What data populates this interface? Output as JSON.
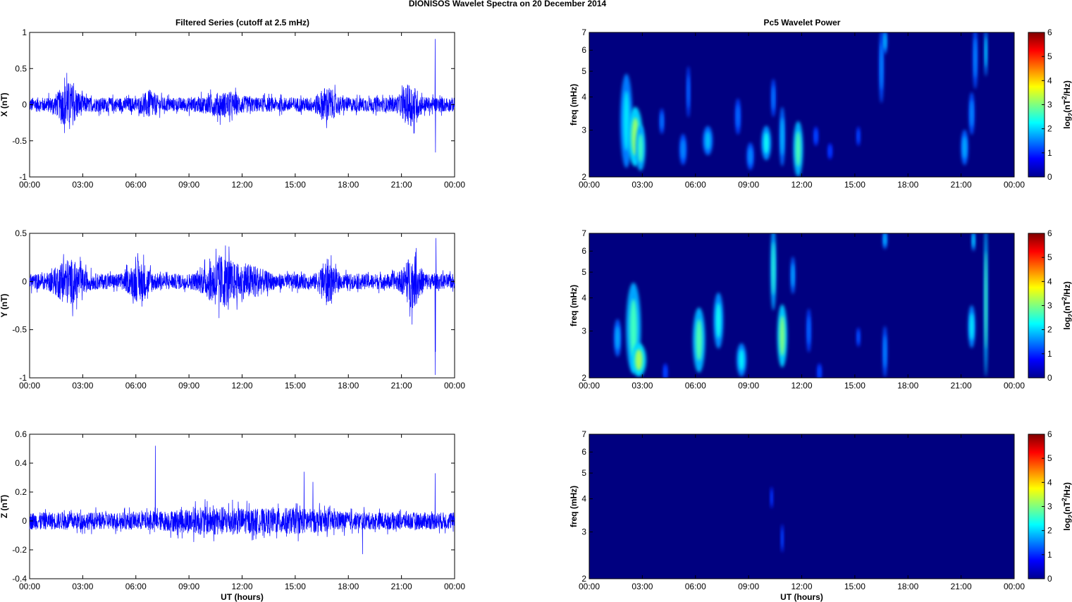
{
  "title": "DIONISOS Wavelet Spectra on 20 December  2014",
  "chart_data": [
    {
      "type": "line",
      "title": "Filtered Series (cutoff at 2.5 mHz)",
      "ylabel": "X (nT)",
      "xlabel": "",
      "ylim": [
        -1,
        1
      ],
      "yticks": [
        "-1",
        "-0.5",
        "0",
        "0.5",
        "1"
      ],
      "ytick_values": [
        -1,
        -0.5,
        0,
        0.5,
        1
      ],
      "base_amplitude": 0.1,
      "bursts": [
        [
          2.2,
          0.22,
          0.6
        ],
        [
          6.8,
          0.1,
          0.4
        ],
        [
          16.8,
          0.16,
          0.5
        ],
        [
          21.5,
          0.2,
          0.5
        ],
        [
          11,
          0.08,
          1
        ]
      ],
      "spikes": [
        [
          22.9,
          0.91
        ],
        [
          22.92,
          -0.66
        ],
        [
          21.7,
          -0.4
        ],
        [
          2.1,
          0.44
        ]
      ]
    },
    {
      "type": "line",
      "title": "",
      "ylabel": "Y (nT)",
      "xlabel": "",
      "ylim": [
        -1,
        0.5
      ],
      "yticks": [
        "-1",
        "-0.5",
        "0",
        "0.5"
      ],
      "ytick_values": [
        -1,
        -0.5,
        0,
        0.5
      ],
      "base_amplitude": 0.08,
      "bursts": [
        [
          2.2,
          0.16,
          0.8
        ],
        [
          6.2,
          0.14,
          0.6
        ],
        [
          10.8,
          0.2,
          0.9
        ],
        [
          12.5,
          0.1,
          0.8
        ],
        [
          16.8,
          0.16,
          0.4
        ],
        [
          21.6,
          0.2,
          0.5
        ]
      ],
      "spikes": [
        [
          22.95,
          0.45
        ],
        [
          22.9,
          -0.97
        ],
        [
          22.92,
          -0.73
        ],
        [
          10.7,
          -0.38
        ]
      ]
    },
    {
      "type": "line",
      "title": "",
      "ylabel": "Z (nT)",
      "xlabel": "UT (hours)",
      "ylim": [
        -0.4,
        0.6
      ],
      "yticks": [
        "-0.4",
        "-0.2",
        "0",
        "0.2",
        "0.4",
        "0.6"
      ],
      "ytick_values": [
        -0.4,
        -0.2,
        0,
        0.2,
        0.4,
        0.6
      ],
      "base_amplitude": 0.06,
      "bursts": [
        [
          10.5,
          0.04,
          2.5
        ],
        [
          15,
          0.03,
          2
        ]
      ],
      "spikes": [
        [
          7.1,
          0.52
        ],
        [
          15.5,
          0.34
        ],
        [
          18.8,
          -0.23
        ],
        [
          22.9,
          0.33
        ],
        [
          16,
          0.27
        ]
      ]
    },
    {
      "type": "heatmap",
      "title": "Pc5 Wavelet Power",
      "ylabel": "freq (mHz)",
      "xlabel": "",
      "colorbar_label": "log2(nT2/Hz)",
      "clim": [
        0,
        6
      ],
      "yticks": [
        "2",
        "3",
        "4",
        "5",
        "6",
        "7"
      ],
      "ytick_values": [
        2,
        3,
        4,
        5,
        6,
        7
      ],
      "blobs": [
        [
          2.1,
          2.3,
          4.6,
          1.5,
          0.25
        ],
        [
          2.6,
          2.3,
          3.5,
          2.5,
          0.3
        ],
        [
          2.9,
          2.2,
          3,
          2,
          0.2
        ],
        [
          4.1,
          3,
          3.5,
          0.9,
          0.1
        ],
        [
          5.3,
          2.3,
          2.8,
          1,
          0.15
        ],
        [
          5.6,
          3.5,
          5,
          0.8,
          0.08
        ],
        [
          6.7,
          2.5,
          3,
          1.3,
          0.2
        ],
        [
          8.4,
          3,
          3.8,
          0.8,
          0.12
        ],
        [
          9.1,
          2.2,
          2.6,
          1,
          0.15
        ],
        [
          10,
          2.4,
          3,
          1.7,
          0.2
        ],
        [
          10.4,
          3.5,
          4.5,
          0.9,
          0.1
        ],
        [
          10.9,
          2.3,
          3.5,
          1.3,
          0.12
        ],
        [
          11.8,
          2.1,
          3.1,
          2.1,
          0.2
        ],
        [
          12.8,
          2.7,
          3,
          0.6,
          0.1
        ],
        [
          13.6,
          2.4,
          2.6,
          0.5,
          0.1
        ],
        [
          15.2,
          2.7,
          3,
          0.6,
          0.08
        ],
        [
          16.5,
          4,
          6.8,
          1,
          0.1
        ],
        [
          16.7,
          6,
          7,
          1.3,
          0.1
        ],
        [
          21.2,
          2.3,
          2.9,
          1.2,
          0.15
        ],
        [
          21.6,
          3,
          4,
          1,
          0.12
        ],
        [
          21.8,
          4.5,
          7,
          1,
          0.1
        ],
        [
          22.4,
          5,
          7,
          1.5,
          0.07
        ]
      ]
    },
    {
      "type": "heatmap",
      "title": "",
      "ylabel": "freq (mHz)",
      "xlabel": "",
      "colorbar_label": "log2(nT2/Hz)",
      "clim": [
        0,
        6
      ],
      "yticks": [
        "2",
        "3",
        "4",
        "5",
        "6",
        "7"
      ],
      "ytick_values": [
        2,
        3,
        4,
        5,
        6,
        7
      ],
      "blobs": [
        [
          1.6,
          2.5,
          3.2,
          1.2,
          0.15
        ],
        [
          2.5,
          2.2,
          4.3,
          2,
          0.3
        ],
        [
          2.8,
          2.1,
          2.6,
          2.6,
          0.3
        ],
        [
          4.3,
          2,
          2.2,
          0.6,
          0.1
        ],
        [
          6.2,
          2.2,
          3.5,
          2.1,
          0.25
        ],
        [
          7.3,
          2.7,
          4,
          1.7,
          0.2
        ],
        [
          8.6,
          2.1,
          2.6,
          1.6,
          0.2
        ],
        [
          10.4,
          3.8,
          7,
          1.9,
          0.12
        ],
        [
          10.9,
          2.3,
          3.6,
          2.4,
          0.2
        ],
        [
          11.5,
          4.3,
          5.5,
          1.2,
          0.1
        ],
        [
          12.4,
          2.6,
          3.5,
          0.8,
          0.1
        ],
        [
          13,
          2,
          2.2,
          0.6,
          0.1
        ],
        [
          15.2,
          2.7,
          3,
          0.7,
          0.08
        ],
        [
          16.7,
          2.1,
          3,
          1,
          0.1
        ],
        [
          16.7,
          6.3,
          7,
          1.3,
          0.1
        ],
        [
          21.6,
          2.7,
          3.6,
          1.6,
          0.15
        ],
        [
          21.7,
          6.2,
          7,
          1.5,
          0.08
        ],
        [
          22.4,
          2.2,
          7,
          2.1,
          0.08
        ]
      ]
    },
    {
      "type": "heatmap",
      "title": "",
      "ylabel": "freq (mHz)",
      "xlabel": "UT (hours)",
      "colorbar_label": "log2(nT2/Hz)",
      "clim": [
        0,
        6
      ],
      "yticks": [
        "2",
        "3",
        "4",
        "5",
        "6",
        "7"
      ],
      "ytick_values": [
        2,
        3,
        4,
        5,
        6,
        7
      ],
      "blobs": [
        [
          10.3,
          3.8,
          4.3,
          0.5,
          0.06
        ],
        [
          10.9,
          2.6,
          3.1,
          0.6,
          0.06
        ]
      ]
    }
  ],
  "xticks": [
    "00:00",
    "03:00",
    "06:00",
    "09:00",
    "12:00",
    "15:00",
    "18:00",
    "21:00",
    "00:00"
  ],
  "colorbar_ticks": [
    "0",
    "1",
    "2",
    "3",
    "4",
    "5",
    "6"
  ]
}
